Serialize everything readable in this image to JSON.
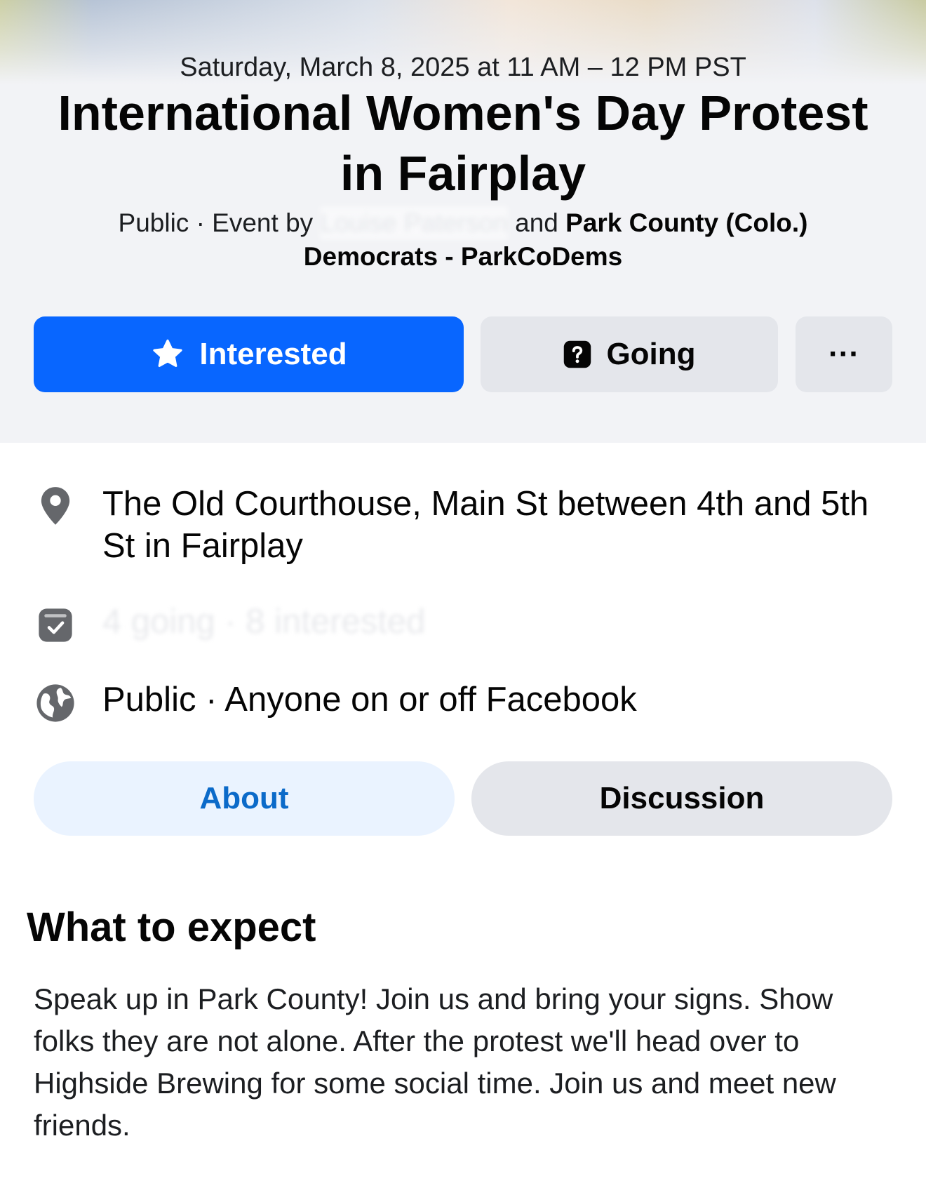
{
  "header": {
    "date": "Saturday, March 8, 2025 at 11 AM – 12 PM PST",
    "title": "International Women's Day Protest in Fairplay",
    "hosts_prefix": "Public · Event by",
    "host_person": "Louise Paterson",
    "hosts_joiner": "and",
    "host_org": "Park County (Colo.) Democrats - ParkCoDems"
  },
  "actions": {
    "interested_label": "Interested",
    "going_label": "Going",
    "more_label": "···",
    "interested_icon": "star-icon",
    "going_icon": "question-mark-icon",
    "accent_color": "#0866ff"
  },
  "details": {
    "location": "The Old Courthouse, Main St between 4th and 5th St in Fairplay",
    "location_icon": "map-pin-icon",
    "guests": "4 going · 8 interested",
    "guests_icon": "guest-list-icon",
    "privacy": "Public · Anyone on or off Facebook",
    "privacy_icon": "globe-icon"
  },
  "tabs": [
    {
      "label": "About",
      "selected": true
    },
    {
      "label": "Discussion",
      "selected": false
    }
  ],
  "about": {
    "section_title": "What to expect",
    "description": "Speak up in Park County! Join us and bring your signs. Show folks they are not alone. After the protest we'll head over to Highside Brewing for some social time. Join us and meet new friends."
  }
}
